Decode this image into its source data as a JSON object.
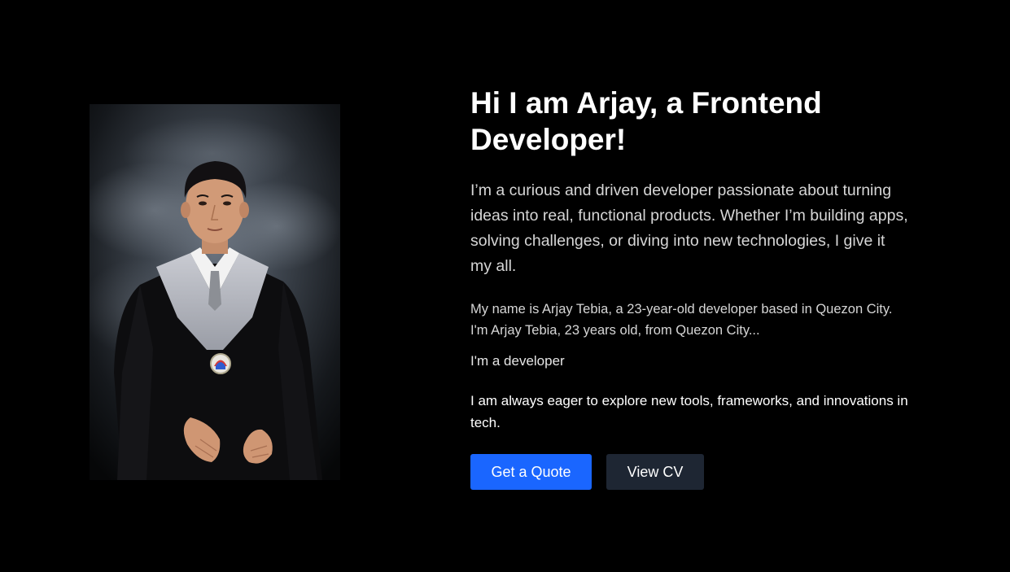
{
  "hero": {
    "photo_alt": "Graduation portrait of Arjay",
    "title": "Hi I am Arjay, a Frontend Developer!",
    "lead": "I’m a curious and driven developer passionate about turning ideas into real, functional products. Whether I’m building apps, solving challenges, or diving into new technologies, I give it my all.",
    "bio": "My name is Arjay Tebia, a 23-year-old developer based in Quezon City. I'm Arjay Tebia, 23 years old, from Quezon City...",
    "short": "I'm a developer",
    "eager": "I am always eager to explore new tools, frameworks, and innovations in tech.",
    "buttons": {
      "quote_label": "Get a Quote",
      "cv_label": "View CV"
    }
  },
  "colors": {
    "background": "#000000",
    "primary": "#1a66ff",
    "secondary": "#1e2633",
    "text": "#ffffff",
    "muted_text": "#d6d6d6"
  }
}
